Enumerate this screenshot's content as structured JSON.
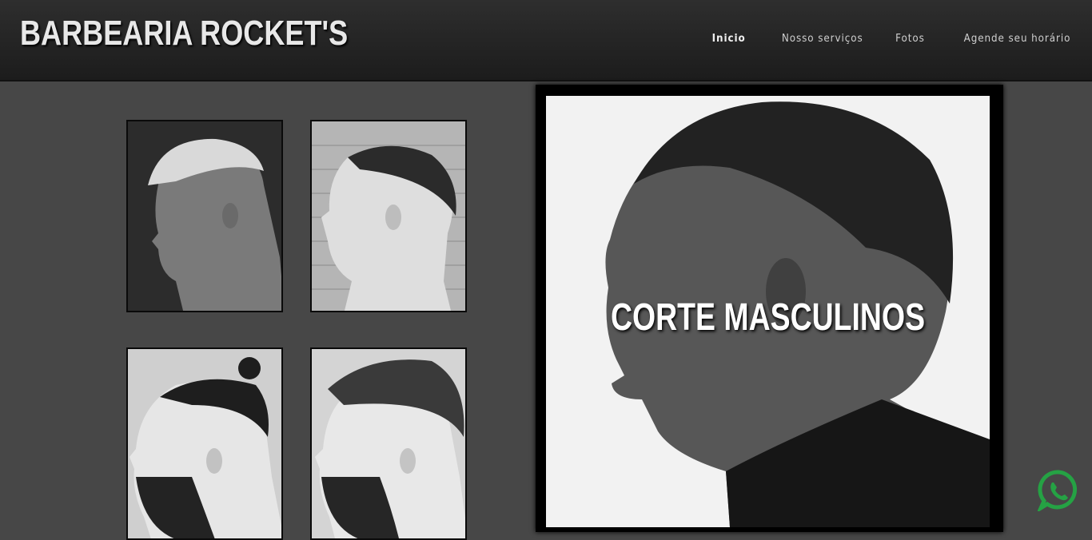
{
  "header": {
    "brand": "BARBEARIA ROCKET'S",
    "nav": [
      "Inicio",
      "Nosso serviços",
      "Fotos",
      "Agende seu horário"
    ]
  },
  "gallery": {
    "thumbnails": [
      {
        "alt": "corte masculino com topete loiro"
      },
      {
        "alt": "corte degradê curto"
      },
      {
        "alt": "corte com coque e barba"
      },
      {
        "alt": "corte pompadour com barba"
      }
    ]
  },
  "hero": {
    "title": "CORTE MASCULINOS"
  },
  "colors": {
    "background": "#474747",
    "header": "#1f1f1f",
    "whatsapp": "#25a244"
  },
  "floating": {
    "whatsapp_icon": "whatsapp-icon"
  }
}
